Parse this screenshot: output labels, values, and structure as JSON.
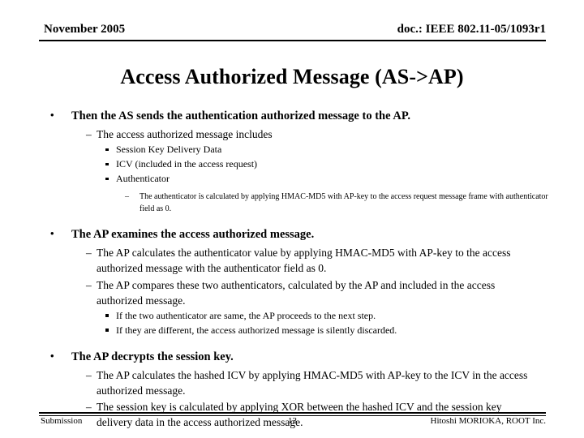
{
  "header": {
    "date": "November 2005",
    "doc_id": "doc.: IEEE 802.11-05/1093r1"
  },
  "title": "Access Authorized Message (AS->AP)",
  "markers": {
    "level1": "•",
    "level2": "–",
    "level4": "–"
  },
  "content": [
    {
      "level": 1,
      "text": "Then the AS sends the authentication authorized message to the AP."
    },
    {
      "level": 2,
      "text": "The access authorized message includes"
    },
    {
      "level": 3,
      "text": "Session Key Delivery Data"
    },
    {
      "level": 3,
      "text": "ICV (included in the access request)"
    },
    {
      "level": 3,
      "text": "Authenticator"
    },
    {
      "level": 4,
      "text": "The authenticator is calculated by applying HMAC-MD5 with AP-key to the access request message frame with authenticator field as 0."
    },
    {
      "level": 1,
      "text": "The AP examines the access authorized message."
    },
    {
      "level": 2,
      "text": "The AP calculates the authenticator value by applying HMAC-MD5 with AP-key to the access authorized message with the authenticator field as 0."
    },
    {
      "level": 2,
      "text": "The AP compares these two authenticators, calculated by the AP and included in the access authorized message."
    },
    {
      "level": 3,
      "text": "If the two authenticator are same, the AP proceeds to the next step."
    },
    {
      "level": 3,
      "text": "If they are different, the access authorized message is silently discarded."
    },
    {
      "level": 1,
      "text": "The AP decrypts the session key."
    },
    {
      "level": 2,
      "text": "The AP calculates the hashed ICV by applying HMAC-MD5 with AP-key to the ICV in the access authorized message."
    },
    {
      "level": 2,
      "text": "The session key is calculated by applying XOR between the hashed ICV and the session key delivery data in the access authorized message."
    }
  ],
  "footer": {
    "left": "Submission",
    "page": "13",
    "right": "Hitoshi MORIOKA, ROOT Inc."
  }
}
